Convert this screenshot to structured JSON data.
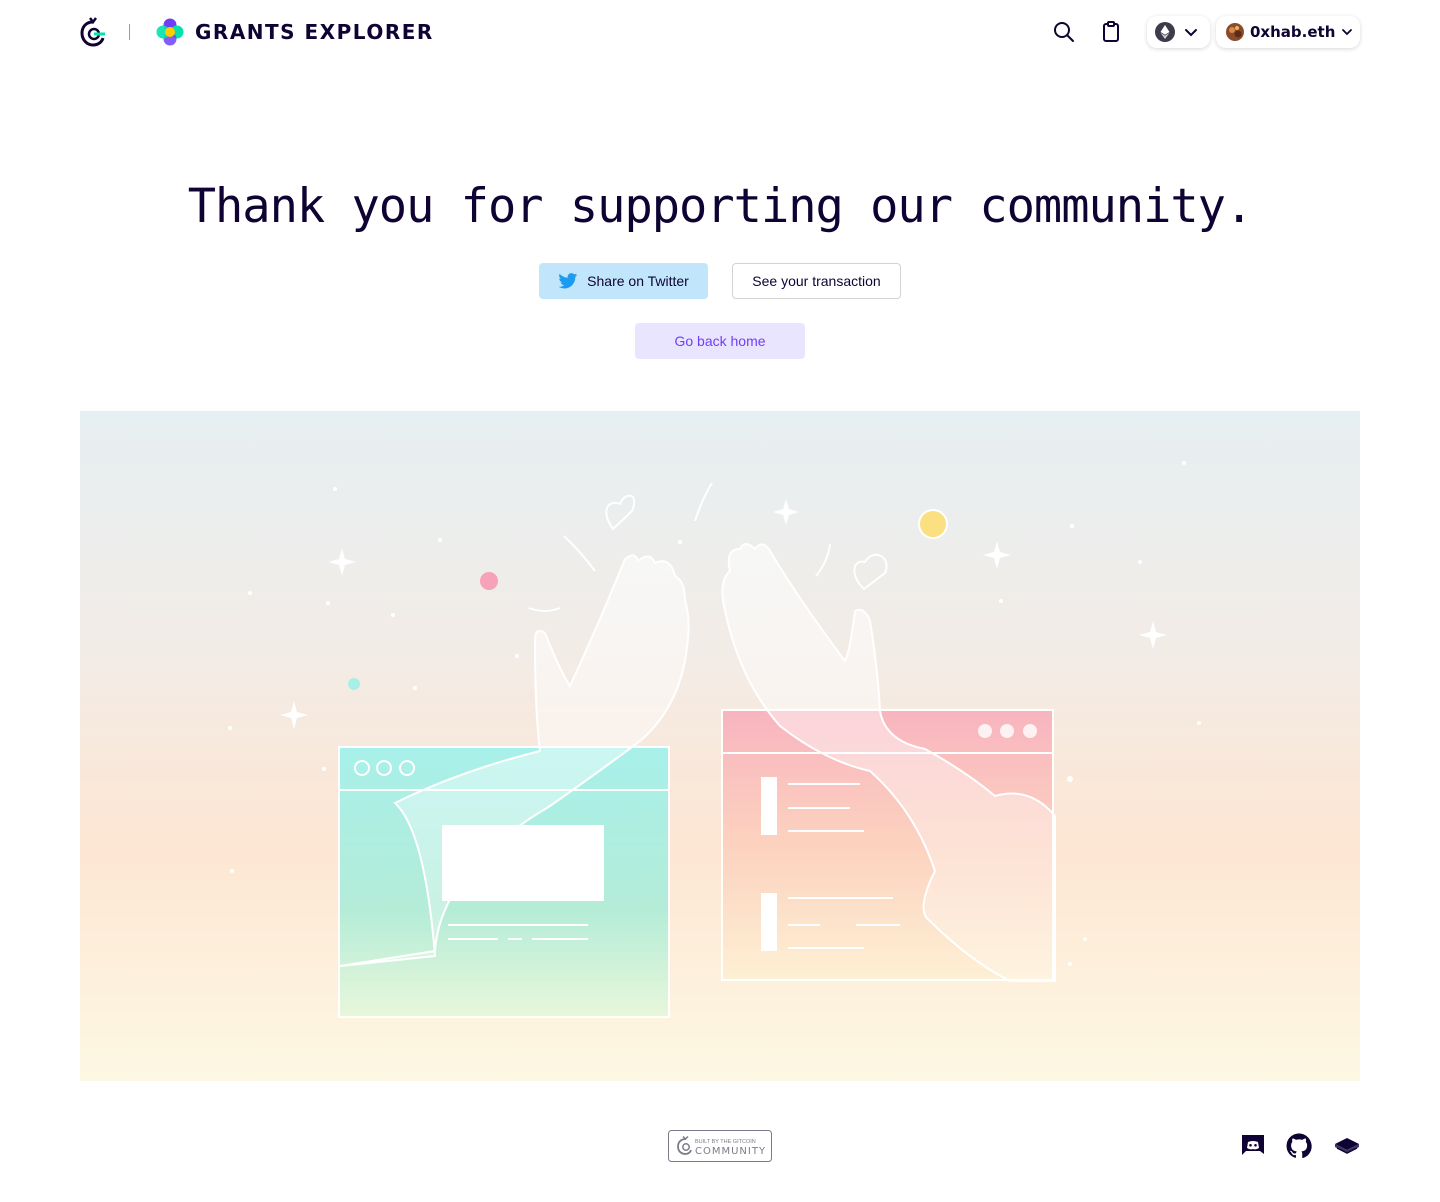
{
  "header": {
    "brand": "GRANTS EXPLORER",
    "account": "0xhab.eth",
    "icons": [
      "gitcoin-logo",
      "grants-explorer-flower-icon",
      "search-icon",
      "clipboard-icon",
      "ethereum-icon",
      "chevron-down-icon",
      "avatar"
    ]
  },
  "hero": {
    "title": "Thank you for supporting our community.",
    "share_twitter_label": "Share on Twitter",
    "see_transaction_label": "See your transaction",
    "go_home_label": "Go back home"
  },
  "footer": {
    "badge_top": "BUILT BY THE GITCOIN",
    "badge_bottom": "COMMUNITY",
    "icons": [
      "discord-icon",
      "github-icon",
      "docs-icon"
    ]
  },
  "colors": {
    "text_dark": "#0e0333",
    "twitter_bg": "#c1e6fb",
    "home_bg": "#eae5ff",
    "home_text": "#6f3ff5",
    "twitter_blue": "#1d9bf0"
  }
}
